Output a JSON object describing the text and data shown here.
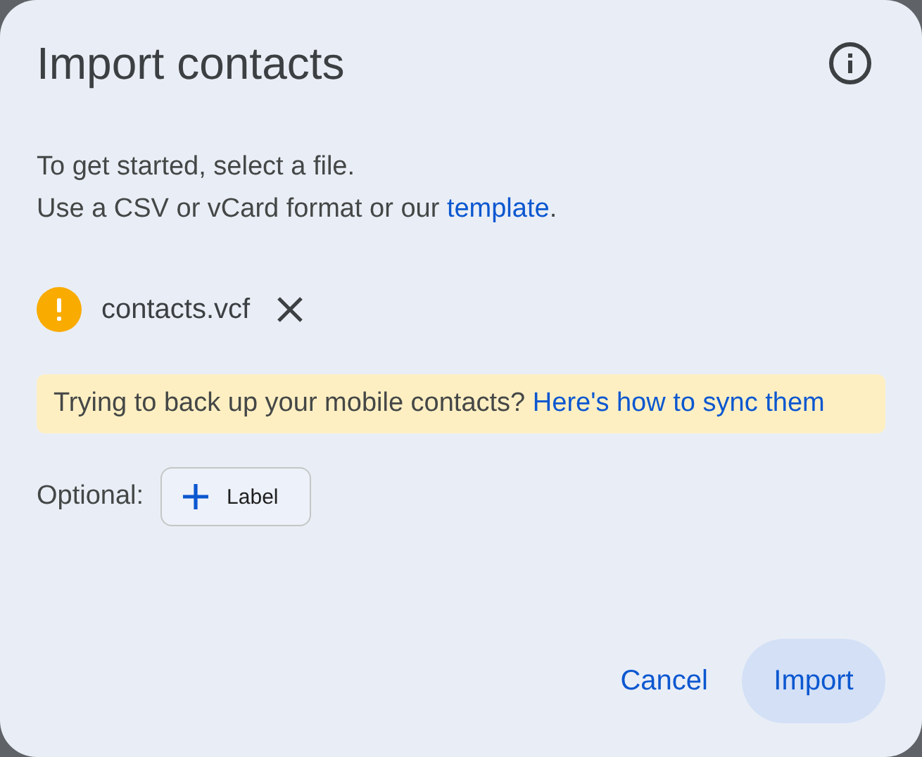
{
  "dialog": {
    "title": "Import contacts"
  },
  "intro": {
    "line1": "To get started, select a file.",
    "line2_before": "Use a CSV or vCard format or our ",
    "line2_link": "template",
    "line2_after": "."
  },
  "file": {
    "name": "contacts.vcf",
    "warning": true
  },
  "banner": {
    "text": "Trying to back up your mobile contacts? ",
    "link": "Here's how to sync them"
  },
  "optional": {
    "label": "Optional:",
    "button": "Label"
  },
  "buttons": [
    {
      "label": "Cancel",
      "kind": "text"
    },
    {
      "label": "Import",
      "kind": "tonal"
    }
  ]
}
